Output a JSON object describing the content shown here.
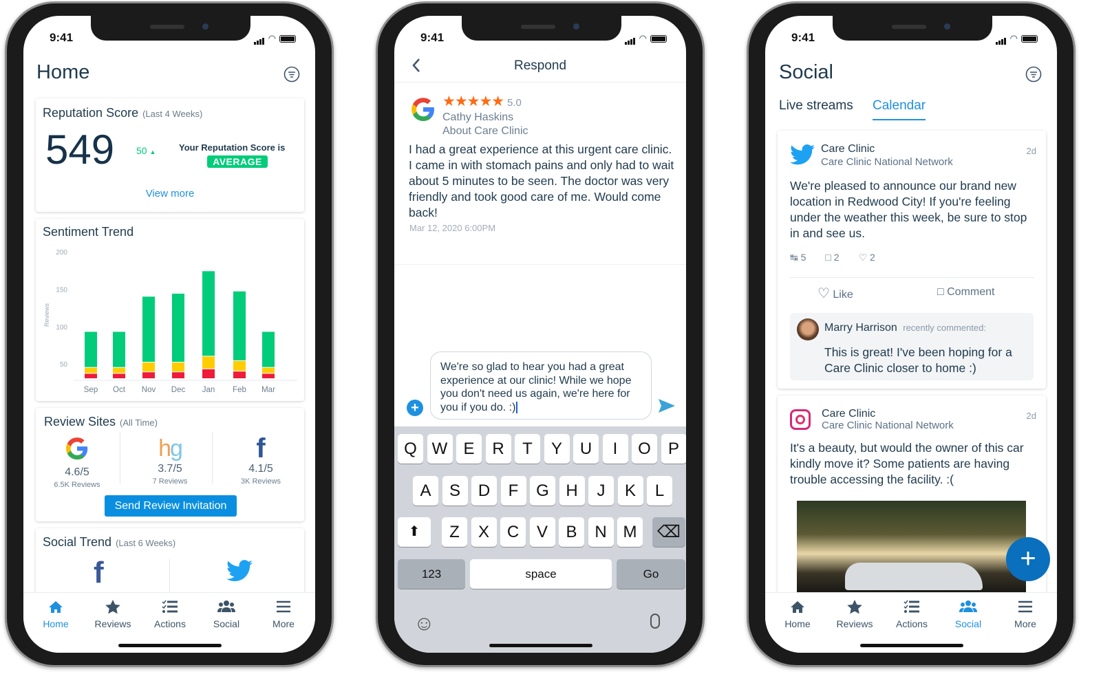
{
  "status_time": "9:41",
  "colors": {
    "accent": "#1e90e0",
    "positive": "#00cc7a",
    "neutral": "#ffcc00",
    "negative": "#ee1b3a",
    "dark_text": "#1f3a4d",
    "star": "#ff6a13",
    "fab": "#0a6fbd"
  },
  "tabs": [
    {
      "label": "Home",
      "icon": "home-icon"
    },
    {
      "label": "Reviews",
      "icon": "star-icon"
    },
    {
      "label": "Actions",
      "icon": "checklist-icon"
    },
    {
      "label": "Social",
      "icon": "people-icon"
    },
    {
      "label": "More",
      "icon": "menu-icon"
    }
  ],
  "home": {
    "title": "Home",
    "filter_icon": "filter-icon",
    "reputation": {
      "title": "Reputation Score",
      "period": "(Last 4 Weeks)",
      "score": "549",
      "change": "50",
      "change_icon": "triangle-up-icon",
      "label": "Your Reputation Score is",
      "badge": "AVERAGE",
      "view_more": "View more"
    },
    "sentiment": {
      "title": "Sentiment Trend"
    },
    "review_sites": {
      "title": "Review Sites",
      "period": "(All Time)",
      "sites": [
        {
          "name": "Google",
          "rating": "4.6/5",
          "reviews": "6.5K Reviews"
        },
        {
          "name": "hg",
          "rating": "3.7/5",
          "reviews": "7 Reviews"
        },
        {
          "name": "Facebook",
          "rating": "4.1/5",
          "reviews": "3K Reviews"
        }
      ],
      "button": "Send Review Invitation"
    },
    "social_trend": {
      "title": "Social Trend",
      "period": "(Last 6 Weeks)"
    },
    "active_tab": "Home"
  },
  "chart_data": {
    "type": "bar",
    "stacked": true,
    "title": "Sentiment Trend",
    "ylabel": "Reviews",
    "ylim": [
      30,
      200
    ],
    "yticks": [
      50,
      100,
      150,
      200
    ],
    "categories": [
      "Sep",
      "Oct",
      "Nov",
      "Dec",
      "Jan",
      "Feb",
      "Mar"
    ],
    "series": [
      {
        "color": "#ee1b3a",
        "values": [
          7,
          7,
          9,
          9,
          13,
          10,
          7
        ]
      },
      {
        "color": "#ffcc00",
        "values": [
          8,
          8,
          13,
          13,
          17,
          14,
          8
        ]
      },
      {
        "color": "#00cc7a",
        "values": [
          48,
          48,
          88,
          92,
          114,
          93,
          48
        ]
      }
    ],
    "grid": false
  },
  "respond": {
    "title": "Respond",
    "rating": "5.0",
    "stars": 5,
    "reviewer": "Cathy Haskins",
    "about": "About Care Clinic",
    "review": "I had a great experience at this urgent care clinic. I came in with stomach pains and only had to wait about 5 minutes to be seen. The doctor was very friendly and took good care of me. Would come back!",
    "date": "Mar 12, 2020 6:00PM",
    "reply": "We're so glad to hear you had a great experience at our clinic! While we hope you don't need us again, we're here for you if you do. :)",
    "keyboard": {
      "row1": [
        "Q",
        "W",
        "E",
        "R",
        "T",
        "Y",
        "U",
        "I",
        "O",
        "P"
      ],
      "row2": [
        "A",
        "S",
        "D",
        "F",
        "G",
        "H",
        "J",
        "K",
        "L"
      ],
      "row3": [
        "Z",
        "X",
        "C",
        "V",
        "B",
        "N",
        "M"
      ],
      "numbers": "123",
      "space": "space",
      "go": "Go"
    }
  },
  "social": {
    "title": "Social",
    "tabs": [
      "Live streams",
      "Calendar"
    ],
    "active_subtab": "Calendar",
    "posts": [
      {
        "network": "twitter",
        "account": "Care Clinic",
        "network_name": "Care Clinic National Network",
        "age": "2d",
        "text": "We're pleased to announce our brand new location in Redwood City! If you're feeling under the weather this week, be sure to stop in and see us.",
        "retweets": "5",
        "comments": "2",
        "likes": "2",
        "like_label": "Like",
        "comment_label": "Comment",
        "comment": {
          "author": "Marry Harrison",
          "meta": "recently commented:",
          "text": "This is great! I've been hoping for a Care Clinic closer to home :)"
        }
      },
      {
        "network": "instagram",
        "account": "Care Clinic",
        "network_name": "Care Clinic National Network",
        "age": "2d",
        "text": "It's a beauty, but would the owner of this car kindly move it? Some patients are having trouble accessing the facility. :("
      }
    ],
    "active_tab": "Social"
  }
}
